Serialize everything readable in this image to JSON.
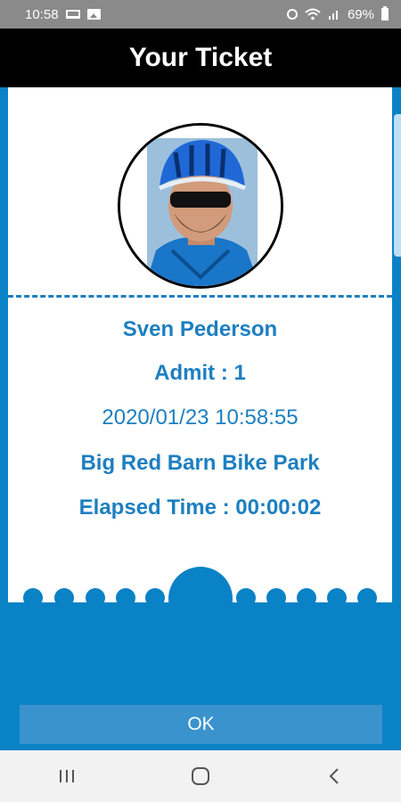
{
  "status_bar": {
    "time": "10:58",
    "battery": "69%"
  },
  "header": {
    "title": "Your Ticket"
  },
  "ticket": {
    "name": "Sven Pederson",
    "admit": "Admit : 1",
    "timestamp": "2020/01/23 10:58:55",
    "location": "Big Red Barn Bike Park",
    "elapsed": "Elapsed Time : 00:00:02"
  },
  "actions": {
    "ok_label": "OK"
  },
  "icons": {
    "status_left": [
      "laptop-icon",
      "image-icon"
    ],
    "status_right": [
      "alarm-icon",
      "wifi-icon",
      "signal-icon",
      "battery-icon"
    ],
    "nav": [
      "recent-apps-icon",
      "home-icon",
      "back-icon"
    ]
  },
  "colors": {
    "accent": "#0a82c6",
    "text": "#1d7fc0",
    "header": "#000000",
    "button": "#3a93cc"
  }
}
